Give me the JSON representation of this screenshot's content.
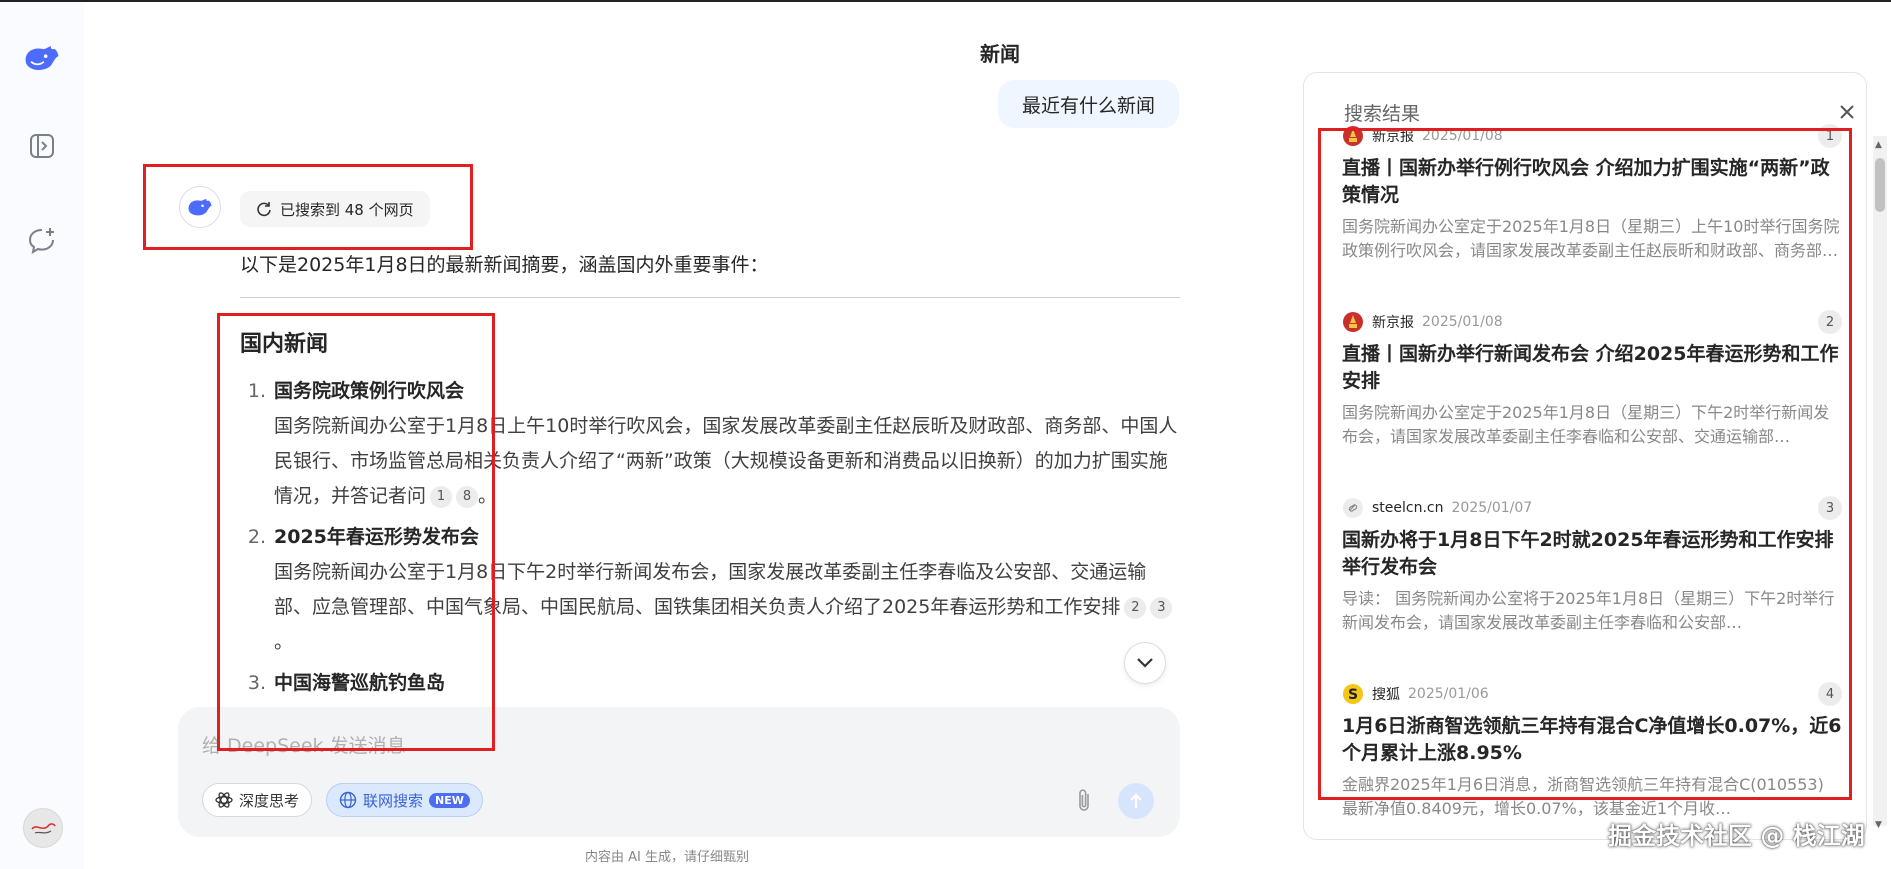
{
  "chat": {
    "title": "新闻",
    "user_message": "最近有什么新闻",
    "search_status": "已搜索到 48 个网页",
    "intro": "以下是2025年1月8日的最新新闻摘要，涵盖国内外重要事件：",
    "section_title": "国内新闻",
    "news": [
      {
        "num": "1.",
        "title": "国务院政策例行吹风会",
        "body": "国务院新闻办公室于1月8日上午10时举行吹风会，国家发展改革委副主任赵辰昕及财政部、商务部、中国人民银行、市场监管总局相关负责人介绍了“两新”政策（大规模设备更新和消费品以旧换新）的加力扩围实施情况，并答记者问",
        "cites": [
          "1",
          "8"
        ],
        "end": "。"
      },
      {
        "num": "2.",
        "title": "2025年春运形势发布会",
        "body": "国务院新闻办公室于1月8日下午2时举行新闻发布会，国家发展改革委副主任李春临及公安部、交通运输部、应急管理部、中国气象局、中国民航局、国铁集团相关负责人介绍了2025年春运形势和工作安排",
        "cites": [
          "2",
          "3"
        ],
        "end": "。"
      },
      {
        "num": "3.",
        "title": "中国海警巡航钓鱼岛",
        "body": "",
        "cites": [],
        "end": ""
      }
    ]
  },
  "input": {
    "placeholder": "给 DeepSeek 发送消息",
    "deep_think_label": "深度思考",
    "web_search_label": "联网搜索",
    "new_badge": "NEW"
  },
  "disclaimer": "内容由 AI 生成，请仔细甄别",
  "panel": {
    "title": "搜索结果",
    "results": [
      {
        "source": "新京报",
        "date": "2025/01/08",
        "num": "1",
        "icon": "xinjingbao-logo-icon",
        "title": "直播丨国新办举行例行吹风会 介绍加力扩围实施“两新”政策情况",
        "snippet": "国务院新闻办公室定于2025年1月8日（星期三）上午10时举行国务院政策例行吹风会，请国家发展改革委副主任赵辰昕和财政部、商务部…"
      },
      {
        "source": "新京报",
        "date": "2025/01/08",
        "num": "2",
        "icon": "xinjingbao-logo-icon",
        "title": "直播丨国新办举行新闻发布会 介绍2025年春运形势和工作安排",
        "snippet": "国务院新闻办公室定于2025年1月8日（星期三）下午2时举行新闻发布会，请国家发展改革委副主任李春临和公安部、交通运输部…"
      },
      {
        "source": "steelcn.cn",
        "date": "2025/01/07",
        "num": "3",
        "icon": "link-icon",
        "title": "国新办将于1月8日下午2时就2025年春运形势和工作安排举行发布会",
        "snippet": "导读： 国务院新闻办公室将于2025年1月8日（星期三）下午2时举行新闻发布会，请国家发展改革委副主任李春临和公安部…"
      },
      {
        "source": "搜狐",
        "date": "2025/01/06",
        "num": "4",
        "icon": "sohu-logo-icon",
        "title": "1月6日浙商智选领航三年持有混合C净值增长0.07%，近6个月累计上涨8.95%",
        "snippet": "金融界2025年1月6日消息，浙商智选领航三年持有混合C(010553) 最新净值0.8409元，增长0.07%，该基金近1个月收…"
      }
    ]
  },
  "watermark": "掘金技术社区 @ 栈江湖",
  "colors": {
    "accent": "#4d6bfe",
    "highlight": "#e02020"
  }
}
